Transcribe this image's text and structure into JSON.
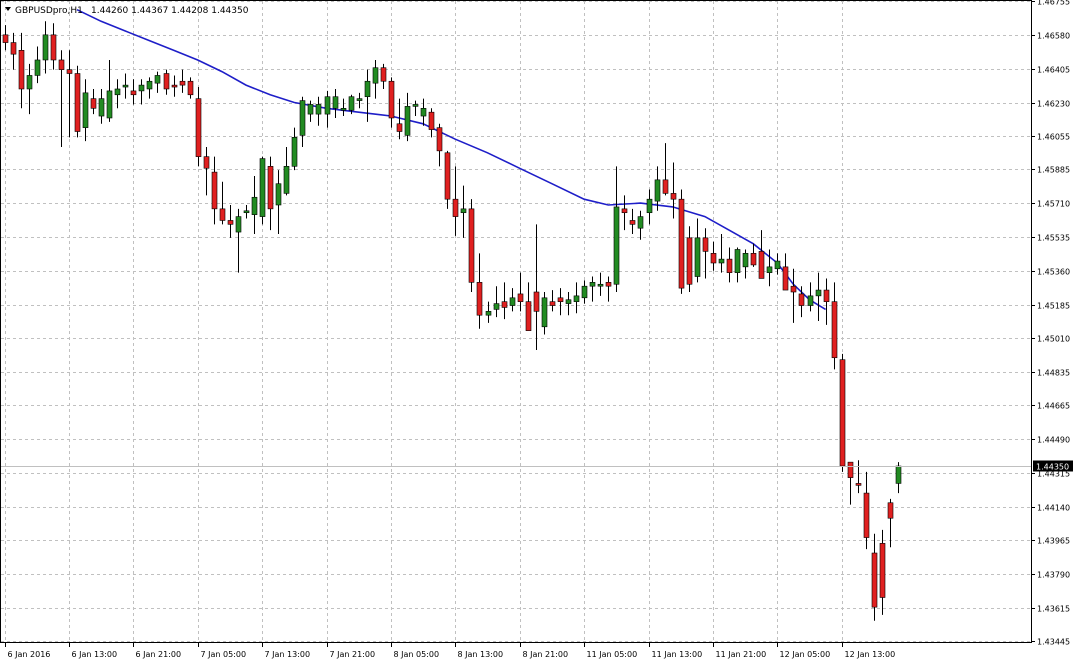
{
  "header": {
    "symbol_timeframe": "GBPUSDpro,H1",
    "ohlc": "1.44260 1.44367 1.44208 1.44350"
  },
  "colors": {
    "background": "#ffffff",
    "grid": "#c0c0c0",
    "axis": "#000000",
    "bull": "#228b22",
    "bear": "#e02020",
    "ma_line": "#1e1ec8",
    "current_price_line": "#c0c0c0"
  },
  "chart_data": {
    "type": "candlestick",
    "symbol": "GBPUSDpro",
    "timeframe": "H1",
    "ylim": [
      1.43445,
      1.46755
    ],
    "grid": true,
    "y_ticks": [
      "1.46755",
      "1.46580",
      "1.46405",
      "1.46230",
      "1.46055",
      "1.45885",
      "1.45710",
      "1.45535",
      "1.45360",
      "1.45185",
      "1.45010",
      "1.44835",
      "1.44665",
      "1.44490",
      "1.44315",
      "1.44140",
      "1.43965",
      "1.43790",
      "1.43615",
      "1.43445"
    ],
    "x_tick_labels": [
      "6 Jan 2016",
      "6 Jan 13:00",
      "6 Jan 21:00",
      "7 Jan 05:00",
      "7 Jan 13:00",
      "7 Jan 21:00",
      "8 Jan 05:00",
      "8 Jan 13:00",
      "8 Jan 21:00",
      "11 Jan 05:00",
      "11 Jan 13:00",
      "11 Jan 21:00",
      "12 Jan 05:00",
      "12 Jan 13:00"
    ],
    "x_tick_bar_index": [
      0,
      8,
      16,
      24,
      32,
      40,
      48,
      56,
      64,
      72,
      80,
      88,
      96,
      104
    ],
    "current_price": "1.44350",
    "candles": [
      [
        1.4658,
        1.4663,
        1.465,
        1.4654
      ],
      [
        1.4654,
        1.4659,
        1.464,
        1.4648
      ],
      [
        1.465,
        1.4659,
        1.462,
        1.463
      ],
      [
        1.463,
        1.4643,
        1.4617,
        1.4637
      ],
      [
        1.4637,
        1.4652,
        1.4633,
        1.4645
      ],
      [
        1.4645,
        1.4665,
        1.4638,
        1.4658
      ],
      [
        1.4658,
        1.4664,
        1.464,
        1.4645
      ],
      [
        1.4645,
        1.465,
        1.46,
        1.464
      ],
      [
        1.464,
        1.465,
        1.4605,
        1.4638
      ],
      [
        1.4638,
        1.4642,
        1.4605,
        1.4608
      ],
      [
        1.461,
        1.4635,
        1.4603,
        1.4628
      ],
      [
        1.4625,
        1.463,
        1.4617,
        1.462
      ],
      [
        1.4616,
        1.463,
        1.4612,
        1.4625
      ],
      [
        1.4615,
        1.4645,
        1.4613,
        1.4629
      ],
      [
        1.4627,
        1.4635,
        1.462,
        1.463
      ],
      [
        1.4631,
        1.4638,
        1.4625,
        1.4632
      ],
      [
        1.4629,
        1.4635,
        1.4622,
        1.4627
      ],
      [
        1.4629,
        1.4635,
        1.4622,
        1.4632
      ],
      [
        1.463,
        1.4636,
        1.4625,
        1.4634
      ],
      [
        1.4633,
        1.4639,
        1.4628,
        1.4637
      ],
      [
        1.4638,
        1.464,
        1.4627,
        1.463
      ],
      [
        1.4632,
        1.4637,
        1.4626,
        1.4631
      ],
      [
        1.4634,
        1.464,
        1.4628,
        1.4632
      ],
      [
        1.4634,
        1.4636,
        1.4625,
        1.4627
      ],
      [
        1.4625,
        1.4631,
        1.459,
        1.4595
      ],
      [
        1.4595,
        1.46,
        1.4575,
        1.4589
      ],
      [
        1.4587,
        1.4595,
        1.456,
        1.4568
      ],
      [
        1.4568,
        1.4582,
        1.456,
        1.4562
      ],
      [
        1.4562,
        1.457,
        1.4553,
        1.456
      ],
      [
        1.4556,
        1.4568,
        1.4535,
        1.4564
      ],
      [
        1.4566,
        1.457,
        1.4563,
        1.4567
      ],
      [
        1.4565,
        1.4585,
        1.4555,
        1.4574
      ],
      [
        1.4564,
        1.4595,
        1.456,
        1.4594
      ],
      [
        1.459,
        1.4595,
        1.4557,
        1.4568
      ],
      [
        1.457,
        1.4588,
        1.4555,
        1.4581
      ],
      [
        1.4576,
        1.46,
        1.4575,
        1.459
      ],
      [
        1.459,
        1.461,
        1.4588,
        1.4605
      ],
      [
        1.4606,
        1.4626,
        1.46,
        1.4624
      ],
      [
        1.4617,
        1.4624,
        1.4613,
        1.4622
      ],
      [
        1.4617,
        1.4626,
        1.4611,
        1.4622
      ],
      [
        1.4617,
        1.4629,
        1.461,
        1.4626
      ],
      [
        1.462,
        1.463,
        1.4615,
        1.4626
      ],
      [
        1.4619,
        1.4625,
        1.4616,
        1.462
      ],
      [
        1.4619,
        1.4627,
        1.4617,
        1.4626
      ],
      [
        1.4624,
        1.4628,
        1.462,
        1.4625
      ],
      [
        1.4626,
        1.464,
        1.4613,
        1.4634
      ],
      [
        1.4633,
        1.4645,
        1.4625,
        1.4641
      ],
      [
        1.4641,
        1.4643,
        1.463,
        1.4634
      ],
      [
        1.4634,
        1.4636,
        1.461,
        1.4615
      ],
      [
        1.4612,
        1.4625,
        1.4604,
        1.4608
      ],
      [
        1.4606,
        1.4628,
        1.4603,
        1.4621
      ],
      [
        1.4621,
        1.4624,
        1.4616,
        1.4622
      ],
      [
        1.4616,
        1.4625,
        1.4611,
        1.462
      ],
      [
        1.4618,
        1.462,
        1.4605,
        1.4609
      ],
      [
        1.461,
        1.4612,
        1.459,
        1.4598
      ],
      [
        1.4597,
        1.4598,
        1.4568,
        1.4573
      ],
      [
        1.4573,
        1.459,
        1.4554,
        1.4564
      ],
      [
        1.4566,
        1.458,
        1.4553,
        1.4568
      ],
      [
        1.4568,
        1.4573,
        1.4525,
        1.453
      ],
      [
        1.453,
        1.4545,
        1.4506,
        1.4513
      ],
      [
        1.4513,
        1.452,
        1.4509,
        1.4515
      ],
      [
        1.4516,
        1.4528,
        1.4512,
        1.4519
      ],
      [
        1.452,
        1.453,
        1.4511,
        1.4517
      ],
      [
        1.4518,
        1.4527,
        1.4515,
        1.4522
      ],
      [
        1.4524,
        1.4535,
        1.4515,
        1.452
      ],
      [
        1.452,
        1.453,
        1.4508,
        1.4505
      ],
      [
        1.4525,
        1.456,
        1.4495,
        1.4515
      ],
      [
        1.4507,
        1.4525,
        1.4503,
        1.4522
      ],
      [
        1.452,
        1.4526,
        1.4515,
        1.4518
      ],
      [
        1.4522,
        1.4527,
        1.4513,
        1.452
      ],
      [
        1.4519,
        1.4525,
        1.4513,
        1.4521
      ],
      [
        1.452,
        1.453,
        1.4514,
        1.4523
      ],
      [
        1.4522,
        1.4531,
        1.4519,
        1.4528
      ],
      [
        1.4528,
        1.4533,
        1.452,
        1.453
      ],
      [
        1.4528,
        1.4535,
        1.4523,
        1.4529
      ],
      [
        1.453,
        1.4533,
        1.452,
        1.4528
      ],
      [
        1.4529,
        1.459,
        1.4525,
        1.4569
      ],
      [
        1.4568,
        1.4575,
        1.4557,
        1.4566
      ],
      [
        1.4562,
        1.4568,
        1.4555,
        1.456
      ],
      [
        1.4558,
        1.4567,
        1.4552,
        1.4564
      ],
      [
        1.4566,
        1.4578,
        1.456,
        1.4573
      ],
      [
        1.4572,
        1.459,
        1.4567,
        1.4583
      ],
      [
        1.4583,
        1.4602,
        1.4575,
        1.4576
      ],
      [
        1.4576,
        1.4592,
        1.4563,
        1.4573
      ],
      [
        1.4573,
        1.4578,
        1.4524,
        1.4527
      ],
      [
        1.4553,
        1.4559,
        1.4525,
        1.4529
      ],
      [
        1.4533,
        1.4563,
        1.453,
        1.4553
      ],
      [
        1.4553,
        1.4558,
        1.4532,
        1.4546
      ],
      [
        1.4545,
        1.4551,
        1.4536,
        1.454
      ],
      [
        1.454,
        1.4555,
        1.4535,
        1.4542
      ],
      [
        1.4542,
        1.4548,
        1.453,
        1.4535
      ],
      [
        1.4535,
        1.4548,
        1.453,
        1.4547
      ],
      [
        1.4538,
        1.4547,
        1.4532,
        1.4545
      ],
      [
        1.4545,
        1.455,
        1.4538,
        1.4539
      ],
      [
        1.4546,
        1.4557,
        1.454,
        1.4532
      ],
      [
        1.4535,
        1.4547,
        1.4528,
        1.4538
      ],
      [
        1.4537,
        1.4545,
        1.4534,
        1.4541
      ],
      [
        1.4538,
        1.4545,
        1.4535,
        1.4526
      ],
      [
        1.4528,
        1.4537,
        1.4509,
        1.4525
      ],
      [
        1.4524,
        1.4528,
        1.4512,
        1.4518
      ],
      [
        1.4518,
        1.453,
        1.4515,
        1.4523
      ],
      [
        1.4523,
        1.4535,
        1.451,
        1.4526
      ],
      [
        1.4526,
        1.4532,
        1.4508,
        1.452
      ],
      [
        1.452,
        1.453,
        1.4485,
        1.4491
      ],
      [
        1.449,
        1.4493,
        1.4432,
        1.4435
      ],
      [
        1.4437,
        1.4437,
        1.4415,
        1.4429
      ],
      [
        1.4426,
        1.4438,
        1.4421,
        1.4425
      ],
      [
        1.4421,
        1.4432,
        1.4392,
        1.4398
      ],
      [
        1.439,
        1.44,
        1.4355,
        1.4362
      ],
      [
        1.4395,
        1.4402,
        1.4358,
        1.4367
      ],
      [
        1.4416,
        1.4418,
        1.4393,
        1.4408
      ],
      [
        1.4426,
        1.4437,
        1.4421,
        1.4435
      ]
    ],
    "ma_points": [
      [
        9,
        1.4671
      ],
      [
        12,
        1.4665
      ],
      [
        15,
        1.466
      ],
      [
        18,
        1.4655
      ],
      [
        21,
        1.465
      ],
      [
        24,
        1.4645
      ],
      [
        27,
        1.4639
      ],
      [
        30,
        1.4632
      ],
      [
        33,
        1.4627
      ],
      [
        36,
        1.4623
      ],
      [
        40,
        1.462
      ],
      [
        44,
        1.4618
      ],
      [
        48,
        1.4616
      ],
      [
        52,
        1.4612
      ],
      [
        56,
        1.4604
      ],
      [
        60,
        1.4597
      ],
      [
        64,
        1.4589
      ],
      [
        68,
        1.4581
      ],
      [
        72,
        1.4573
      ],
      [
        75,
        1.457
      ],
      [
        79,
        1.4571
      ],
      [
        83,
        1.4569
      ],
      [
        87,
        1.4564
      ],
      [
        90,
        1.4557
      ],
      [
        93,
        1.455
      ],
      [
        96,
        1.454
      ],
      [
        98,
        1.4529
      ],
      [
        100,
        1.4521
      ],
      [
        102,
        1.4516
      ]
    ]
  }
}
